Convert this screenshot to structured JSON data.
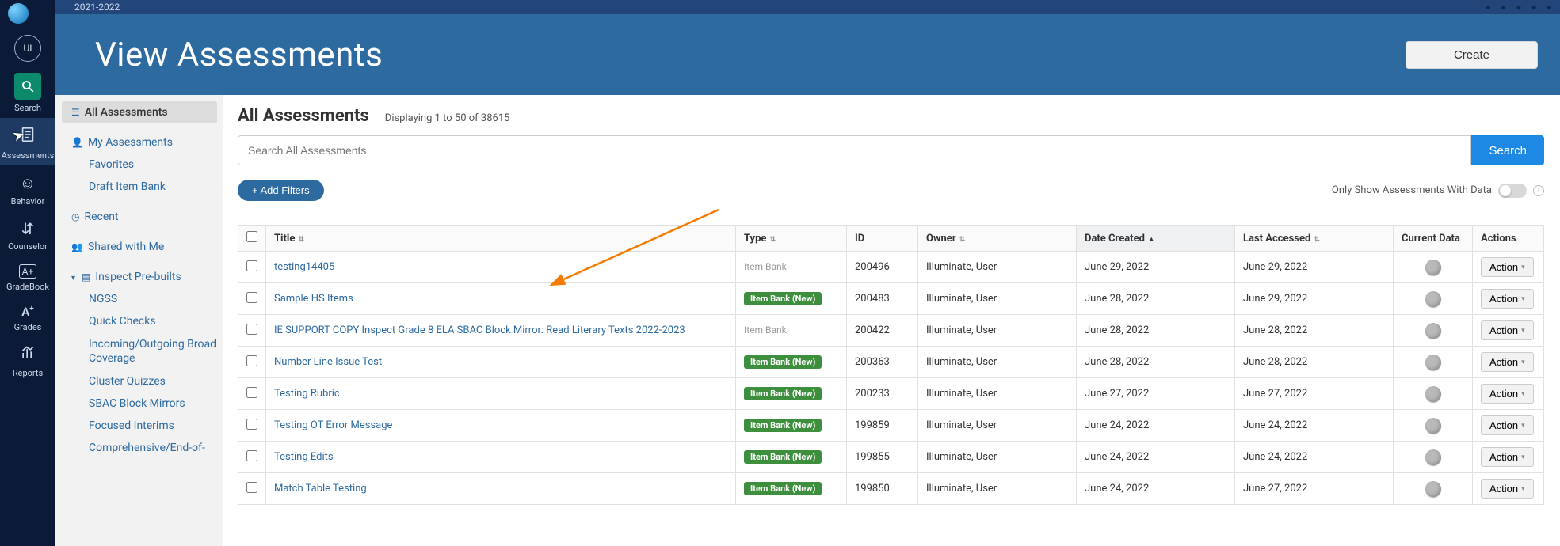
{
  "topbar": {
    "year": "2021-2022"
  },
  "rail": {
    "avatar": "UI",
    "items": [
      {
        "key": "search",
        "label": "Search"
      },
      {
        "key": "assessments",
        "label": "Assessments"
      },
      {
        "key": "behavior",
        "label": "Behavior"
      },
      {
        "key": "counselor",
        "label": "Counselor"
      },
      {
        "key": "gradebook",
        "label": "GradeBook"
      },
      {
        "key": "grades",
        "label": "Grades"
      },
      {
        "key": "reports",
        "label": "Reports"
      }
    ]
  },
  "hero": {
    "title": "View Assessments",
    "create": "Create"
  },
  "sidebar": {
    "all": "All Assessments",
    "my": "My Assessments",
    "favorites": "Favorites",
    "draft": "Draft Item Bank",
    "recent": "Recent",
    "shared": "Shared with Me",
    "inspect": "Inspect Pre-builts",
    "inspect_children": [
      "NGSS",
      "Quick Checks",
      "Incoming/Outgoing Broad Coverage",
      "Cluster Quizzes",
      "SBAC Block Mirrors",
      "Focused Interims",
      "Comprehensive/End-of-"
    ]
  },
  "main": {
    "heading": "All Assessments",
    "count": "Displaying 1 to 50 of 38615",
    "search_placeholder": "Search All Assessments",
    "search_btn": "Search",
    "add_filters": "+ Add Filters",
    "only_data": "Only Show Assessments With Data",
    "columns": {
      "title": "Title",
      "type": "Type",
      "id": "ID",
      "owner": "Owner",
      "date_created": "Date Created",
      "last_accessed": "Last Accessed",
      "current_data": "Current Data",
      "actions": "Actions"
    },
    "action_label": "Action",
    "type_new_badge": "Item Bank (New)",
    "type_plain": "Item Bank",
    "rows": [
      {
        "title": "testing14405",
        "type": "plain",
        "id": "200496",
        "owner": "Illuminate, User",
        "created": "June 29, 2022",
        "accessed": "June 29, 2022"
      },
      {
        "title": "Sample HS Items",
        "type": "new",
        "id": "200483",
        "owner": "Illuminate, User",
        "created": "June 28, 2022",
        "accessed": "June 29, 2022"
      },
      {
        "title": "IE SUPPORT COPY Inspect Grade 8 ELA SBAC Block Mirror: Read Literary Texts 2022-2023",
        "type": "plain",
        "id": "200422",
        "owner": "Illuminate, User",
        "created": "June 28, 2022",
        "accessed": "June 28, 2022"
      },
      {
        "title": "Number Line Issue Test",
        "type": "new",
        "id": "200363",
        "owner": "Illuminate, User",
        "created": "June 28, 2022",
        "accessed": "June 28, 2022"
      },
      {
        "title": "Testing Rubric",
        "type": "new",
        "id": "200233",
        "owner": "Illuminate, User",
        "created": "June 27, 2022",
        "accessed": "June 27, 2022"
      },
      {
        "title": "Testing OT Error Message",
        "type": "new",
        "id": "199859",
        "owner": "Illuminate, User",
        "created": "June 24, 2022",
        "accessed": "June 24, 2022"
      },
      {
        "title": "Testing Edits",
        "type": "new",
        "id": "199855",
        "owner": "Illuminate, User",
        "created": "June 24, 2022",
        "accessed": "June 24, 2022"
      },
      {
        "title": "Match Table Testing",
        "type": "new",
        "id": "199850",
        "owner": "Illuminate, User",
        "created": "June 24, 2022",
        "accessed": "June 27, 2022"
      }
    ]
  }
}
